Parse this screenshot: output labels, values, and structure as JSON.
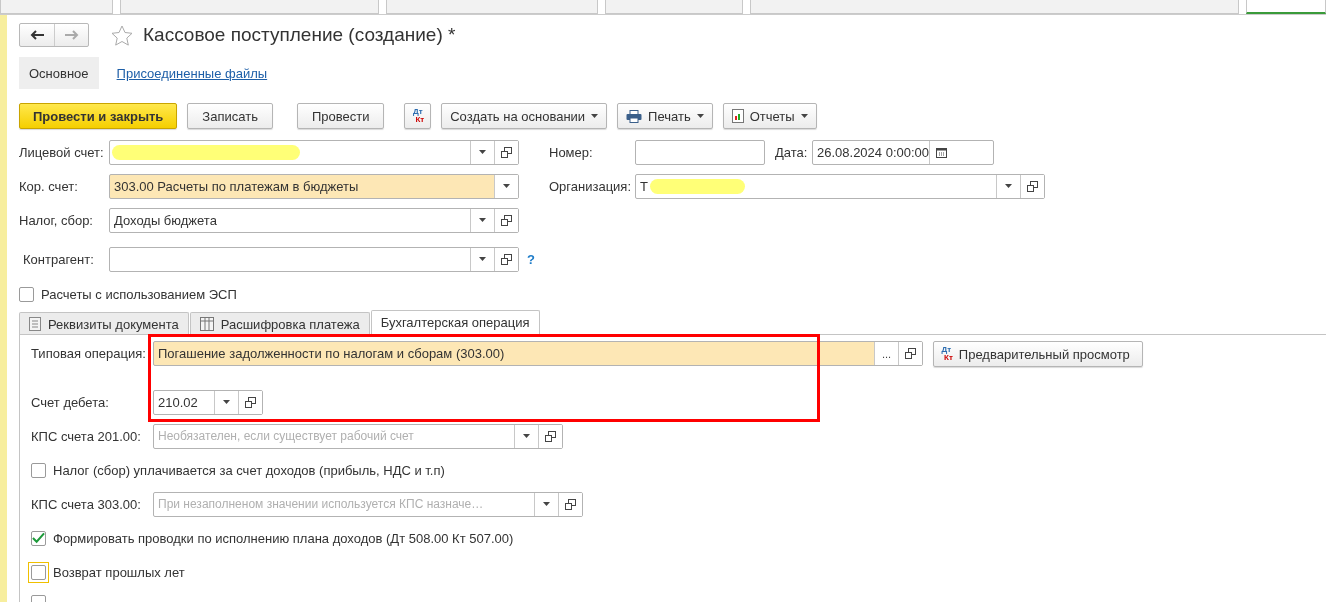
{
  "window_tabs": [
    {
      "selected": false
    },
    {
      "selected": false
    },
    {
      "selected": false
    },
    {
      "selected": false
    },
    {
      "selected": false
    },
    {
      "selected": true
    }
  ],
  "header": {
    "title": "Кассовое поступление (создание) *"
  },
  "form_tabs": [
    {
      "label": "Основное",
      "selected": true
    },
    {
      "label": "Присоединенные файлы",
      "selected": false
    }
  ],
  "toolbar": [
    {
      "kind": "primary",
      "label": "Провести и закрыть"
    },
    {
      "kind": "button",
      "label": "Записать"
    },
    {
      "kind": "button",
      "label": "Провести"
    },
    {
      "kind": "dtkt",
      "dt": "Дт",
      "kt": "Кт"
    },
    {
      "kind": "menu",
      "label": "Создать на основании"
    },
    {
      "kind": "print_menu",
      "label": "Печать"
    },
    {
      "kind": "report_menu",
      "label": "Отчеты"
    }
  ],
  "left_fields": [
    {
      "label": "Лицевой счет:",
      "redacted": true,
      "highlighted": false,
      "open_button": true
    },
    {
      "label": "Кор. счет:",
      "value": "303.00 Расчеты по платежам в бюджеты",
      "redacted": false,
      "highlighted": true,
      "open_button": false
    },
    {
      "label": "Налог, сбор:",
      "value": "Доходы бюджета",
      "redacted": false,
      "highlighted": false,
      "open_button": true
    },
    {
      "label": "Контрагент:",
      "redacted": false,
      "highlighted": false,
      "open_button": true,
      "help": "?"
    }
  ],
  "number": {
    "label": "Номер:"
  },
  "date": {
    "label": "Дата:",
    "value": "26.08.2024  0:00:00"
  },
  "organization": {
    "label": "Организация:",
    "value": "Т",
    "redacted": true
  },
  "esp_checkbox": {
    "label": "Расчеты с использованием ЭСП",
    "checked": false
  },
  "doc_tabs": [
    {
      "kind": "document",
      "label": "Реквизиты документа",
      "selected": false
    },
    {
      "kind": "table",
      "label": "Расшифровка платежа",
      "selected": false
    },
    {
      "kind": "plain",
      "label": "Бухгалтерская операция",
      "selected": true
    }
  ],
  "panel": [
    {
      "kind": "field",
      "label": "Типовая операция:",
      "value": "Погашение задолженности по налогам и сборам (303.00)",
      "highlighted": true,
      "choose_button": "...",
      "open_button": true
    },
    {
      "kind": "field",
      "label": "Счет дебета:",
      "value": "210.02",
      "highlighted": false,
      "open_button": true
    },
    {
      "kind": "field",
      "label": "КПС счета 201.00:",
      "placeholder": "Необязателен, если существует рабочий счет",
      "highlighted": false,
      "open_button": true
    },
    {
      "kind": "checkbox",
      "label": "Налог (сбор) уплачивается за счет доходов (прибыль, НДС и т.п)",
      "checked": false,
      "focused": false
    },
    {
      "kind": "field",
      "label": "КПС счета 303.00:",
      "placeholder": "При незаполненом значении используется КПС назначе…",
      "highlighted": false,
      "open_button": true
    },
    {
      "kind": "checkbox",
      "label": "Формировать проводки по исполнению плана доходов (Дт 508.00 Кт 507.00)",
      "checked": true,
      "focused": false
    },
    {
      "kind": "checkbox",
      "label": "Возврат прошлых лет",
      "checked": false,
      "focused": true
    },
    {
      "kind": "checkbox",
      "checked": false
    }
  ],
  "preview_button": {
    "dt": "Дт",
    "kt": "Кт",
    "label": "Предварительный просмотр"
  },
  "annotation": {
    "kind": "frame",
    "color": "#ff0000"
  }
}
